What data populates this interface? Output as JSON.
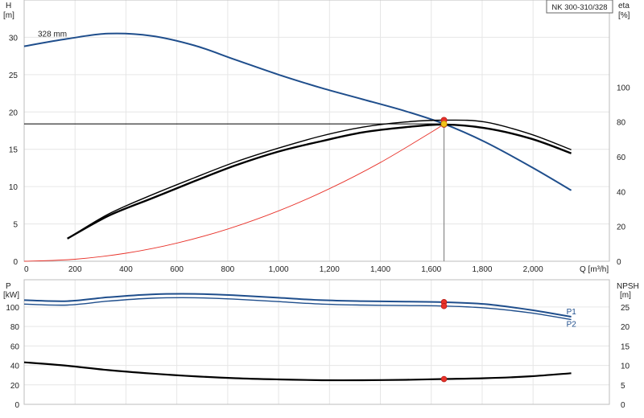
{
  "chart_data": [
    {
      "type": "line",
      "title": "NK 300-310/328",
      "x_axis": {
        "label": "Q [m³/h]",
        "range": [
          0,
          2300
        ],
        "ticks": [
          0,
          200,
          400,
          600,
          800,
          1000,
          1200,
          1400,
          1600,
          1800,
          2000
        ],
        "tick_labels": [
          "0",
          "200",
          "400",
          "600",
          "800",
          "1,000",
          "1,200",
          "1,400",
          "1,600",
          "1,800",
          "2,000"
        ]
      },
      "y_left": {
        "label": "H",
        "unit": "[m]",
        "range": [
          0,
          35
        ],
        "ticks": [
          0,
          5,
          10,
          15,
          20,
          25,
          30
        ]
      },
      "y_right": {
        "label": "eta",
        "unit": "[%]",
        "range": [
          0,
          150
        ],
        "ticks": [
          0,
          20,
          40,
          60,
          80,
          100
        ]
      },
      "grid": true,
      "series": [
        {
          "id": "head",
          "color": "#1f4e8c",
          "axis": "left",
          "label": "328 mm",
          "x": [
            0,
            170,
            330,
            500,
            670,
            830,
            1000,
            1170,
            1330,
            1500,
            1650,
            1810,
            1990,
            2150
          ],
          "y": [
            28.8,
            29.8,
            30.5,
            30.2,
            28.9,
            27.0,
            25.0,
            23.2,
            21.7,
            20.1,
            18.4,
            16.0,
            12.7,
            9.5
          ]
        },
        {
          "id": "eta-thin",
          "color": "#000000",
          "axis": "right",
          "x": [
            170,
            330,
            500,
            670,
            830,
            1000,
            1170,
            1330,
            1500,
            1650,
            1810,
            1990,
            2150
          ],
          "y": [
            13,
            27,
            38,
            48,
            57,
            65,
            72,
            77,
            80,
            81,
            80,
            73,
            64
          ]
        },
        {
          "id": "eta-thick",
          "color": "#000000",
          "axis": "right",
          "x": [
            170,
            330,
            500,
            670,
            830,
            1000,
            1170,
            1330,
            1500,
            1650,
            1810,
            1990,
            2150
          ],
          "y": [
            13,
            26,
            36,
            46,
            55,
            63,
            69,
            74,
            77,
            78.5,
            76.5,
            70.5,
            62
          ]
        },
        {
          "id": "system",
          "color": "#e8322a",
          "axis": "left",
          "x": [
            0,
            200,
            400,
            600,
            800,
            1000,
            1200,
            1400,
            1600,
            1650
          ],
          "y": [
            0,
            0.27,
            1.08,
            2.43,
            4.32,
            6.75,
            9.72,
            13.23,
            17.28,
            18.4
          ]
        }
      ],
      "duty_point": {
        "q": 1650,
        "h": 18.4
      },
      "markers": [
        {
          "x": 1650,
          "y_right": 81,
          "color": "#e8322a"
        },
        {
          "x": 1650,
          "y_right": 78.5,
          "color": "#e8322a"
        },
        {
          "x": 1650,
          "y_left": 18.4,
          "color": "#f2c21b"
        }
      ]
    },
    {
      "type": "line",
      "x_axis": {
        "range": [
          0,
          2300
        ]
      },
      "y_left": {
        "label": "P",
        "unit": "[kW]",
        "range": [
          0,
          128
        ],
        "ticks": [
          0,
          20,
          40,
          60,
          80,
          100
        ],
        "tick_labels": [
          "0",
          "20",
          "40",
          "60",
          "80",
          "100"
        ]
      },
      "y_right": {
        "label": "NPSH",
        "unit": "[m]",
        "range": [
          0,
          32
        ],
        "ticks": [
          0,
          5,
          10,
          15,
          20,
          25
        ],
        "tick_labels": [
          "0",
          "5",
          "10",
          "15",
          "20",
          "25"
        ]
      },
      "grid": true,
      "series": [
        {
          "id": "P1",
          "name": "P1",
          "color": "#1f4e8c",
          "axis": "left",
          "x": [
            0,
            170,
            330,
            500,
            670,
            830,
            1000,
            1170,
            1330,
            1500,
            1650,
            1810,
            1990,
            2150
          ],
          "y": [
            107,
            106,
            110,
            113,
            113.5,
            112,
            109.5,
            107,
            106,
            105.5,
            105,
            103,
            97,
            90
          ]
        },
        {
          "id": "P2",
          "name": "P2",
          "color": "#1f4e8c",
          "axis": "left",
          "x": [
            0,
            170,
            330,
            500,
            670,
            830,
            1000,
            1170,
            1330,
            1500,
            1650,
            1810,
            1990,
            2150
          ],
          "y": [
            103,
            102,
            106,
            109,
            109.5,
            108,
            105.5,
            103,
            102,
            101.5,
            101,
            99,
            94,
            87
          ]
        },
        {
          "id": "NPSH",
          "color": "#000000",
          "axis": "right",
          "x": [
            0,
            170,
            330,
            500,
            670,
            830,
            1000,
            1170,
            1330,
            1500,
            1650,
            1810,
            1990,
            2150
          ],
          "y": [
            10.8,
            9.9,
            8.8,
            7.9,
            7.2,
            6.7,
            6.4,
            6.2,
            6.2,
            6.3,
            6.5,
            6.7,
            7.2,
            8.0
          ]
        }
      ],
      "markers": [
        {
          "x": 1650,
          "y_left": 105,
          "color": "#e8322a"
        },
        {
          "x": 1650,
          "y_left": 101,
          "color": "#e8322a"
        },
        {
          "x": 1650,
          "y_right": 6.5,
          "color": "#e8322a"
        }
      ]
    }
  ]
}
